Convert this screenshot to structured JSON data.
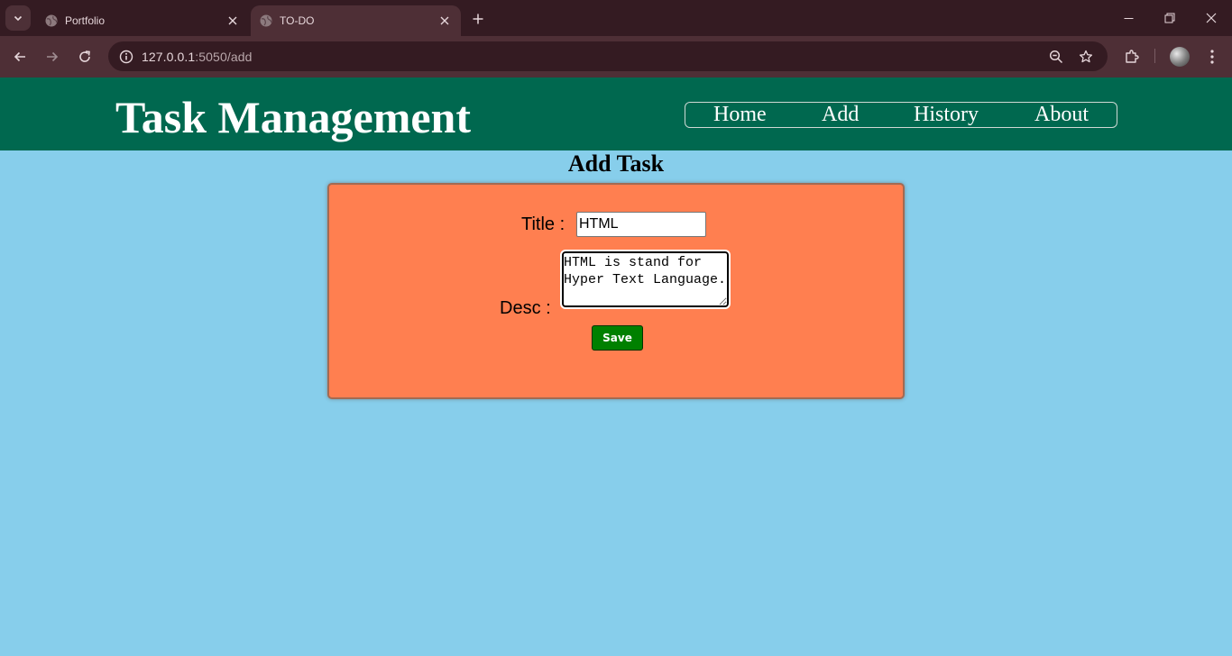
{
  "browser": {
    "tabs": [
      {
        "title": "Portfolio",
        "active": false
      },
      {
        "title": "TO-DO",
        "active": true
      }
    ],
    "url_host": "127.0.0.1",
    "url_path": ":5050/add"
  },
  "header": {
    "title": "Task Management",
    "nav": [
      "Home",
      "Add",
      "History",
      "About"
    ]
  },
  "page": {
    "heading": "Add Task"
  },
  "form": {
    "title_label": "Title :",
    "title_value": "HTML",
    "desc_label": "Desc :",
    "desc_value": "HTML is stand for Hyper Text Language.",
    "save_label": "Save"
  },
  "colors": {
    "header_bg": "#00684f",
    "page_bg": "#87ceeb",
    "card_bg": "#ff7f50",
    "save_bg": "#008000",
    "chrome_dark": "#341b22",
    "chrome_mid": "#4e2f36"
  },
  "icons": [
    "tab-list-icon",
    "globe-icon",
    "close-icon",
    "plus-icon",
    "minimize-icon",
    "restore-icon",
    "back-icon",
    "forward-icon",
    "reload-icon",
    "info-icon",
    "zoom-icon",
    "star-icon",
    "extensions-icon",
    "menu-icon"
  ]
}
